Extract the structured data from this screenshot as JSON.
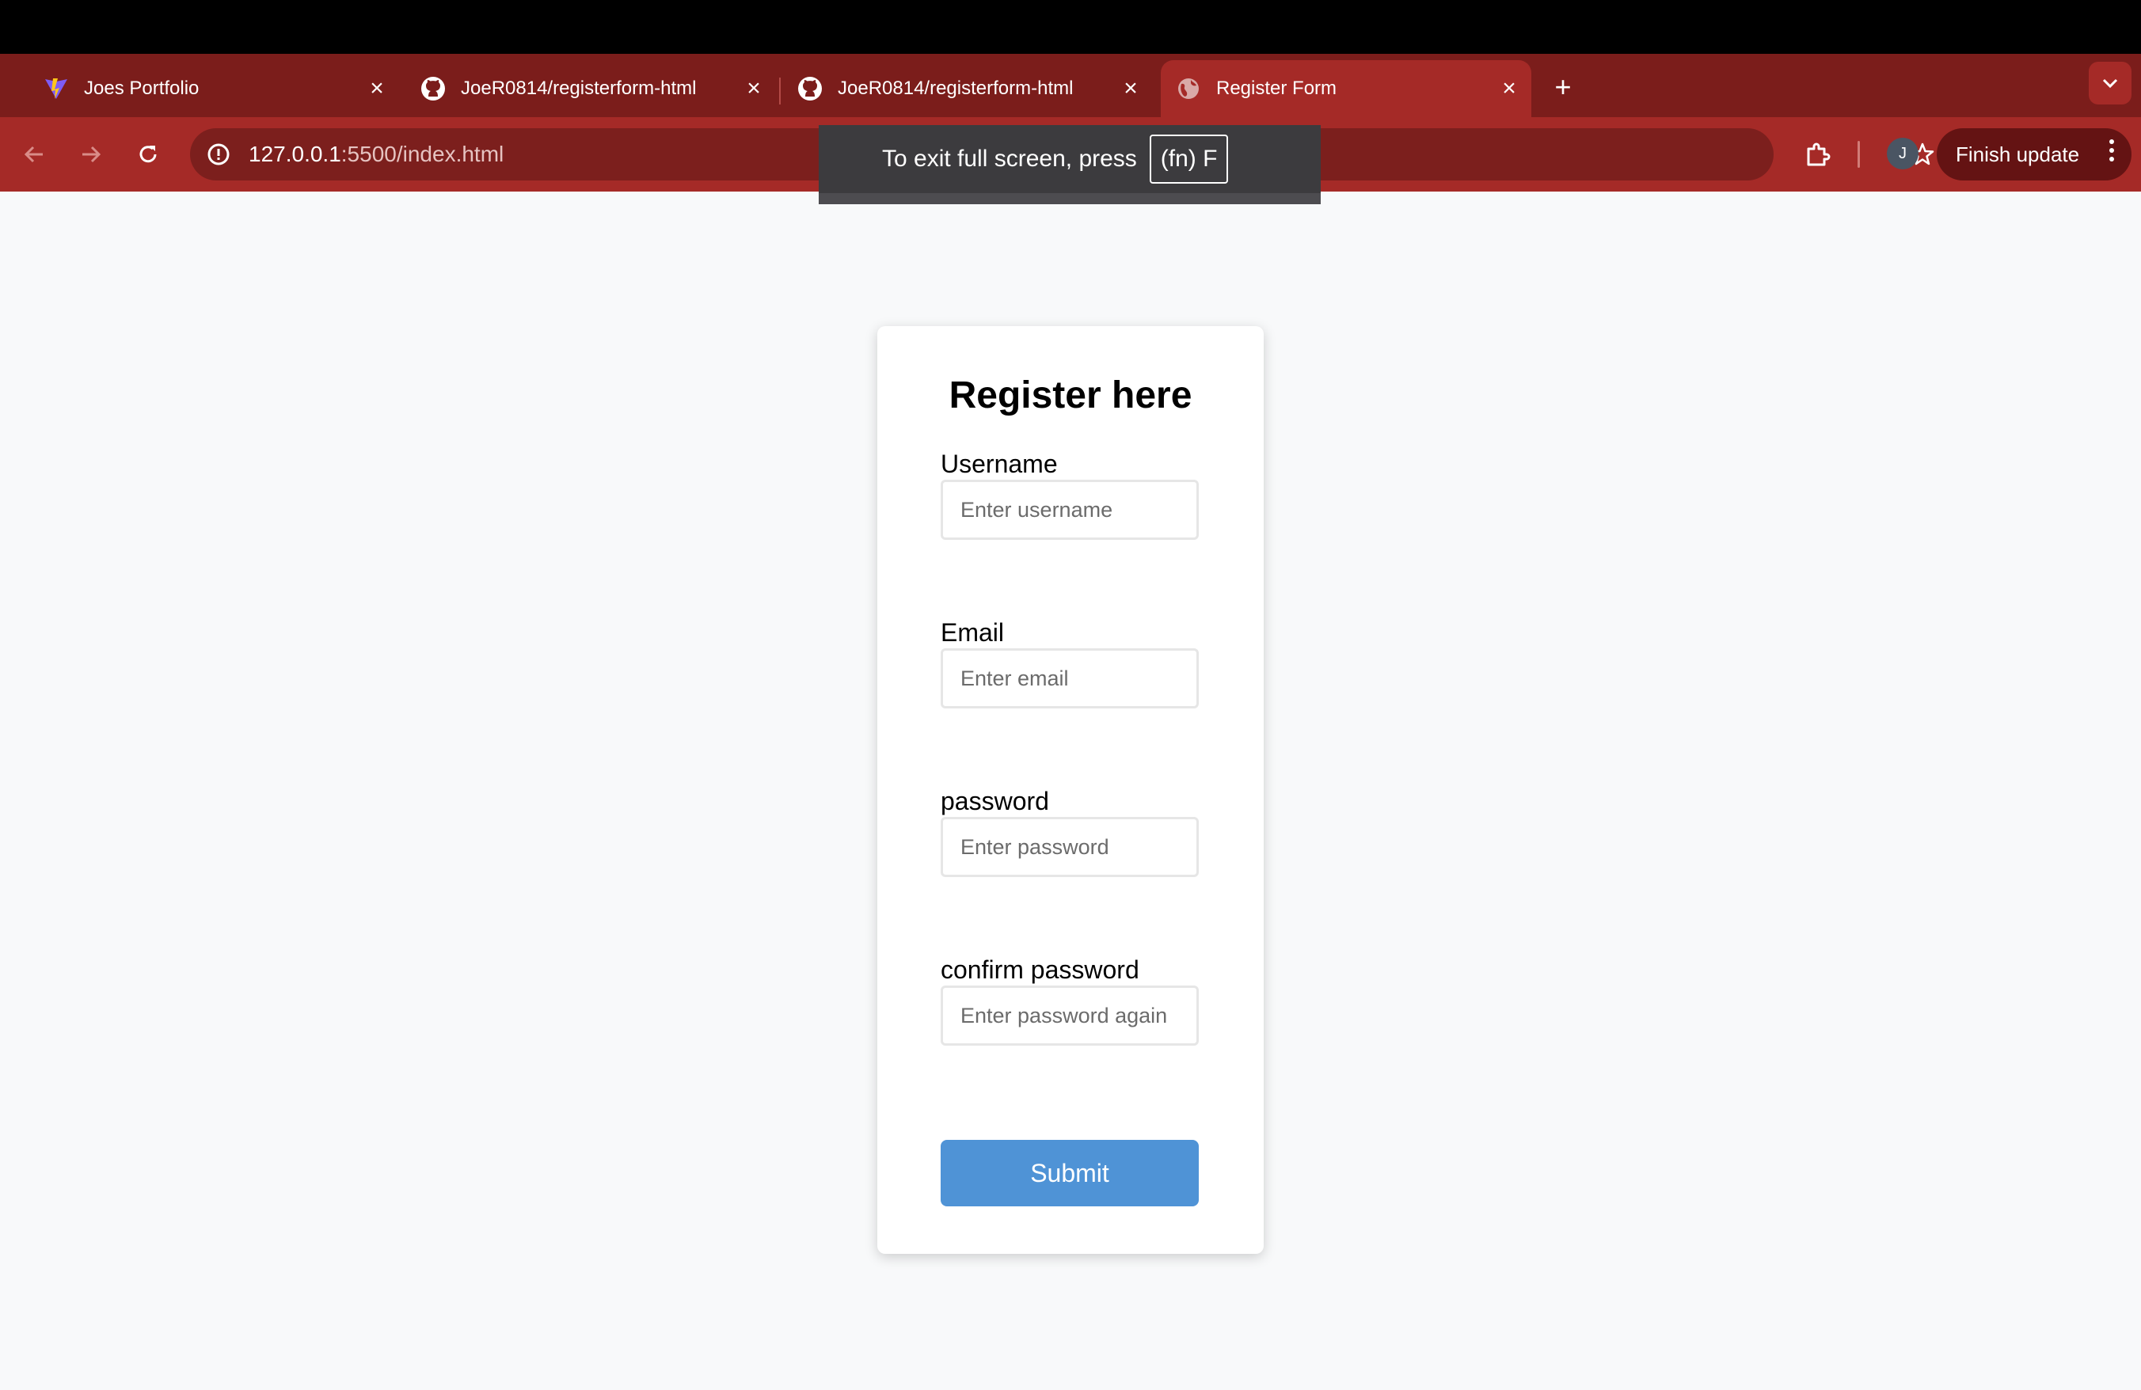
{
  "browser": {
    "tabs": [
      {
        "title": "Joes Portfolio",
        "icon": "vite-logo-icon",
        "active": false
      },
      {
        "title": "JoeR0814/registerform-html",
        "icon": "github-icon",
        "active": false
      },
      {
        "title": "JoeR0814/registerform-html",
        "icon": "github-icon",
        "active": false
      },
      {
        "title": "Register Form",
        "icon": "globe-icon",
        "active": true
      }
    ],
    "address": {
      "host": "127.0.0.1",
      "path": ":5500/index.html"
    },
    "profile_initial": "J",
    "finish_update_label": "Finish update",
    "colors": {
      "frame": "#a52a27",
      "tabstrip": "#7b1d1b",
      "omnibox": "#7c1f1d"
    }
  },
  "fullscreen_notice": {
    "text": "To exit full screen, press",
    "key": "(fn) F"
  },
  "form": {
    "title": "Register here",
    "fields": [
      {
        "label": "Username",
        "placeholder": "Enter username"
      },
      {
        "label": "Email",
        "placeholder": "Enter email"
      },
      {
        "label": "password",
        "placeholder": "Enter password"
      },
      {
        "label": "confirm password",
        "placeholder": "Enter password again"
      }
    ],
    "submit_label": "Submit",
    "colors": {
      "submit": "#4f93d6",
      "background": "#f8f9fa"
    }
  }
}
